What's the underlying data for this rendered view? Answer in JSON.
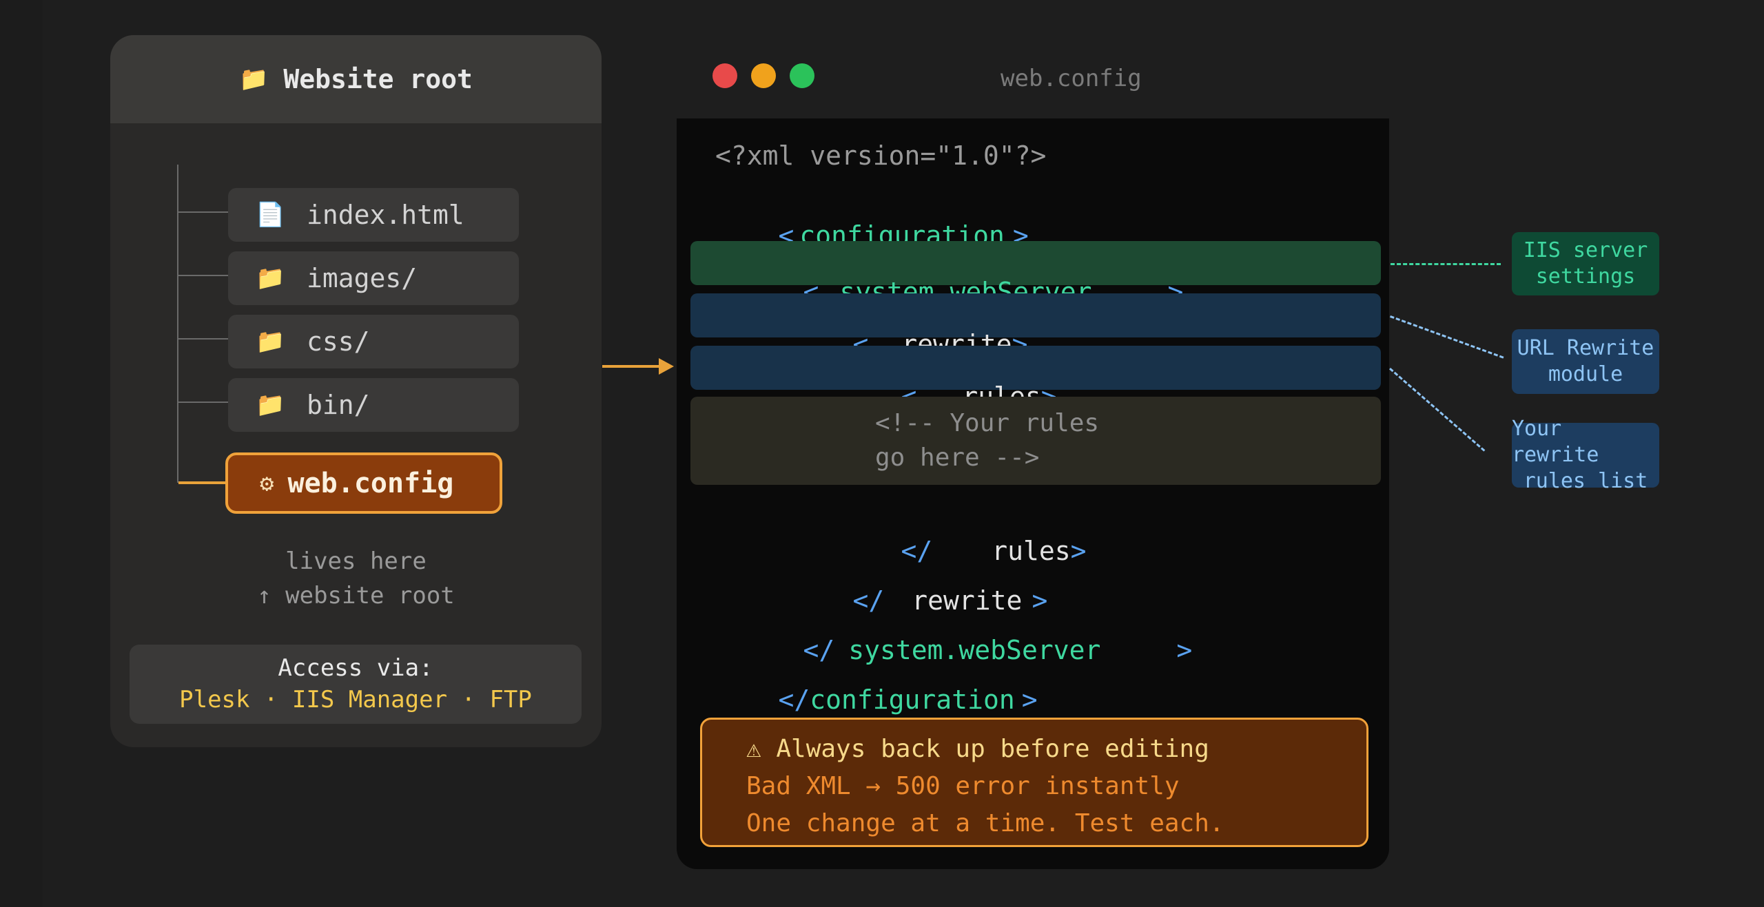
{
  "tree": {
    "header_icon": "folder-icon",
    "header_title": "Website root",
    "files": [
      {
        "icon": "file-icon",
        "glyph": "📄",
        "name": "index.html"
      },
      {
        "icon": "folder-icon",
        "glyph": "📁",
        "name": "images/"
      },
      {
        "icon": "folder-icon",
        "glyph": "📁",
        "name": "css/"
      },
      {
        "icon": "folder-icon",
        "glyph": "📁",
        "name": "bin/"
      }
    ],
    "config": {
      "icon": "gear-icon",
      "glyph": "⚙",
      "name": "web.config"
    },
    "caption_line1": "lives here",
    "caption_line2": "↑ website root",
    "access_label": "Access via:",
    "access_value": "Plesk · IIS Manager · FTP"
  },
  "editor": {
    "title": "web.config",
    "window_dots": [
      "#e84a4a",
      "#f0a21c",
      "#2bc25a"
    ],
    "lines": {
      "xml_decl": "<?xml version=\"1.0\"?>",
      "config_open_lt": "<",
      "config_open_name": "configuration",
      "config_open_gt": ">",
      "sws_open_lt": "<",
      "sws_open_name": "system.webServer",
      "sws_open_gt": ">",
      "rewrite_open_lt": "<",
      "rewrite_open_name": "rewrite",
      "rewrite_open_gt": ">",
      "rules_open_lt": "<",
      "rules_open_name": "rules",
      "rules_open_gt": ">",
      "comment_line1": "<!-- Your rules",
      "comment_line2": "go here -->",
      "rules_close_lt": "</",
      "rules_close_name": "rules",
      "rules_close_gt": ">",
      "rewrite_close_lt": "</",
      "rewrite_close_name": "rewrite",
      "rewrite_close_gt": ">",
      "sws_close_lt": "</",
      "sws_close_name": "system.webServer",
      "sws_close_gt": ">",
      "config_close_lt": "</",
      "config_close_name": "configuration",
      "config_close_gt": ">"
    },
    "warning": {
      "line1": "⚠ Always back up before editing",
      "line2": "Bad XML → 500 error instantly",
      "line3": "One change at a time. Test each."
    }
  },
  "annotations": [
    {
      "line1": "IIS server",
      "line2": "settings",
      "color": "#3fd8a0",
      "bg": "#0e4a34"
    },
    {
      "line1": "URL Rewrite",
      "line2": "module",
      "color": "#8ec4f4",
      "bg": "#1d3d60"
    },
    {
      "line1": "Your rewrite",
      "line2": "rules list",
      "color": "#8ec4f4",
      "bg": "#1d3d60"
    }
  ],
  "colors": {
    "accent_orange": "#f0a23a",
    "xml_blue": "#5aa2f0",
    "xml_green": "#3fd8a0",
    "access_yellow": "#f3c84c"
  }
}
